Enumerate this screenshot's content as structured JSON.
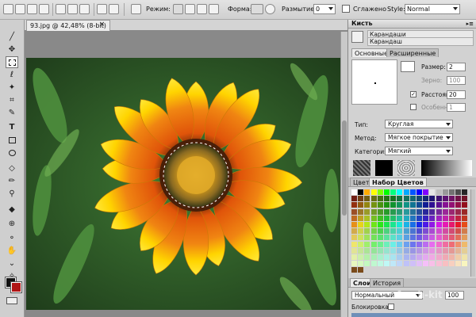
{
  "toolbar": {
    "mode_label": "Режим:",
    "shape_label": "Форма:",
    "blur_label": "Размытие:",
    "blur_value": "0",
    "smooth_label": "Сглажено",
    "style_label": "Style:",
    "style_value": "Normal"
  },
  "tools": [
    "brush-icon",
    "move-icon",
    "marquee-icon",
    "lasso-icon",
    "magic-wand-icon",
    "crop-icon",
    "eyedropper-icon",
    "text-icon",
    "rectangle-icon",
    "ellipse-icon",
    "eraser-icon",
    "pencil-icon",
    "dropper-icon",
    "fill-icon",
    "clone-icon",
    "zoom-icon",
    "hand-icon",
    "pen-icon",
    "sharpen-icon"
  ],
  "document": {
    "title": "93.jpg @ 42,48% (8-bit)",
    "close_glyph": "×"
  },
  "brush_panel": {
    "title": "Кисть",
    "preset_name": "Карандаши",
    "preset_sub": "Карандаш",
    "tab_basic": "Основные",
    "tab_advanced": "Расширенные",
    "size_label": "Размер:",
    "size_value": "2",
    "grain_label": "Зерно:",
    "grain_value": "100",
    "spacing_label": "Расстоян:",
    "spacing_value": "20",
    "special_label": "Особенн:",
    "special_value": "1",
    "type_label": "Тип:",
    "type_value": "Круглая",
    "method_label": "Метод:",
    "method_value": "Мягкое покрытие",
    "category_label": "Категория:",
    "category_value": "Мягкий"
  },
  "color_panel": {
    "tab_color": "Цвет",
    "tab_swatches": "Набор Цветов"
  },
  "layers_panel": {
    "tab_layers": "Слои",
    "tab_history": "История",
    "blend_value": "Нормальный",
    "opacity_value": "100",
    "lock_label": "Блокировка:"
  },
  "watermark": "fresh-kit"
}
